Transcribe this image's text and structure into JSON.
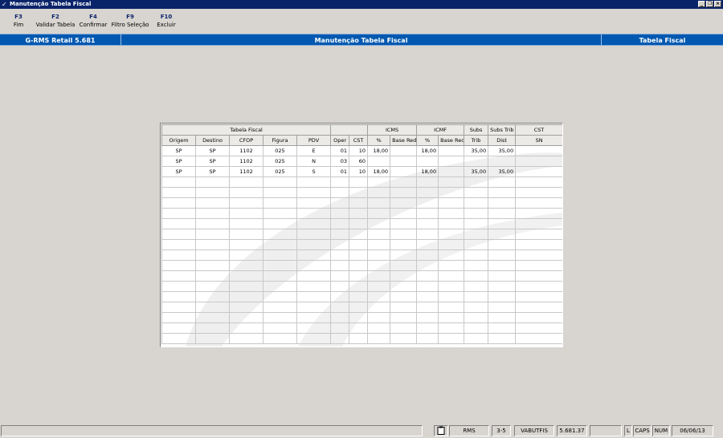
{
  "window": {
    "title": "Manutenção Tabela Fiscal"
  },
  "fkeys": [
    {
      "key": "F3",
      "label": "Fim"
    },
    {
      "key": "F2",
      "label": "Validar Tabela"
    },
    {
      "key": "F4",
      "label": "Confirmar"
    },
    {
      "key": "F9",
      "label": "Filtro Seleção"
    },
    {
      "key": "F10",
      "label": "Excluir"
    }
  ],
  "header": {
    "app": "G-RMS Retail 5.681",
    "title": "Manutenção Tabela Fiscal",
    "section": "Tabela Fiscal"
  },
  "grid": {
    "group_headers": {
      "tabela_fiscal": "Tabela Fiscal",
      "icms": "ICMS",
      "icmf": "ICMF",
      "subs": "Subs",
      "subs_trib": "Subs Trib",
      "cst": "CST"
    },
    "columns": [
      "Origem",
      "Destino",
      "CFOP",
      "Figura",
      "PDV",
      "Oper",
      "CST",
      "%",
      "Base Red",
      "%",
      "Base Red",
      "Trib",
      "Dist",
      "SN"
    ],
    "rows": [
      [
        "SP",
        "SP",
        "1102",
        "025",
        "E",
        "01",
        "10",
        "18,00",
        "",
        "18,00",
        "",
        "35,00",
        "35,00",
        ""
      ],
      [
        "SP",
        "SP",
        "1102",
        "025",
        "N",
        "03",
        "60",
        "",
        "",
        "",
        "",
        "",
        "",
        ""
      ],
      [
        "SP",
        "SP",
        "1102",
        "025",
        "S",
        "01",
        "10",
        "18,00",
        "",
        "18,00",
        "",
        "35,00",
        "35,00",
        ""
      ]
    ]
  },
  "status": {
    "system": "RMS",
    "code": "3-5",
    "user": "VABUTFIS",
    "version": "5.681.37",
    "l": "L",
    "caps": "CAPS",
    "num": "NUM",
    "date": "06/06/13"
  }
}
